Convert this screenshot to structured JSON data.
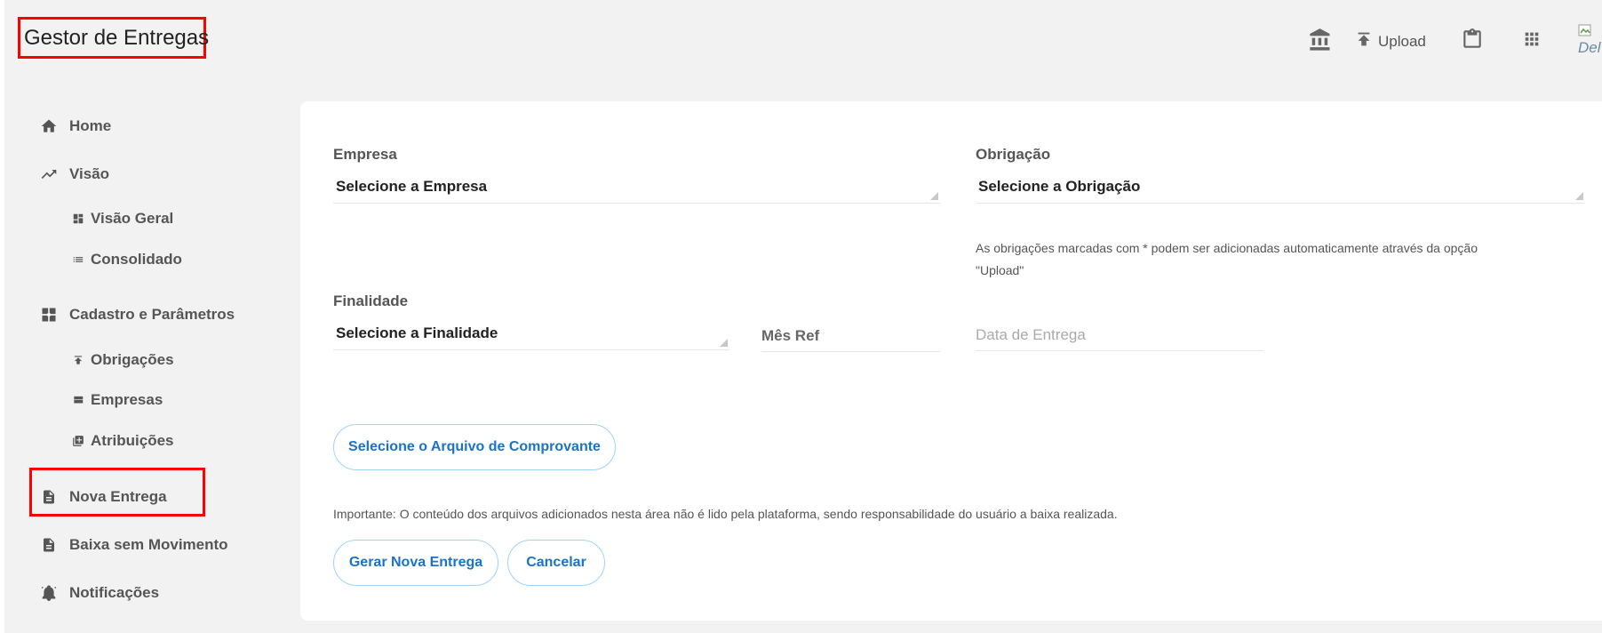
{
  "app": {
    "title": "Gestor de Entregas"
  },
  "topbar": {
    "upload_label": "Upload",
    "broken_image_alt": "Del"
  },
  "sidebar": {
    "items": [
      {
        "label": "Home",
        "icon": "home-icon"
      },
      {
        "label": "Visão",
        "icon": "trending-up-icon"
      },
      {
        "label": "Visão Geral",
        "icon": "dashboard-icon"
      },
      {
        "label": "Consolidado",
        "icon": "list-icon"
      },
      {
        "label": "Cadastro e Parâmetros",
        "icon": "settings-box-icon"
      },
      {
        "label": "Obrigações",
        "icon": "upload-small-icon"
      },
      {
        "label": "Empresas",
        "icon": "view-stream-icon"
      },
      {
        "label": "Atribuições",
        "icon": "add-to-queue-icon"
      },
      {
        "label": "Nova Entrega",
        "icon": "document-icon"
      },
      {
        "label": "Baixa sem Movimento",
        "icon": "document-icon"
      },
      {
        "label": "Notificações",
        "icon": "bell-icon"
      }
    ]
  },
  "form": {
    "empresa_label": "Empresa",
    "empresa_value": "Selecione a Empresa",
    "obrigacao_label": "Obrigação",
    "obrigacao_value": "Selecione a Obrigação",
    "obrigacao_hint_line1": "As obrigações marcadas com * podem ser adicionadas automaticamente através da opção",
    "obrigacao_hint_line2": "\"Upload\"",
    "finalidade_label": "Finalidade",
    "finalidade_value": "Selecione a Finalidade",
    "mes_ref_placeholder": "Mês Ref",
    "data_entrega_placeholder": "Data de Entrega",
    "file_button": "Selecione o Arquivo de Comprovante",
    "note": "Importante: O conteúdo dos arquivos adicionados nesta área não é lido pela plataforma, sendo responsabilidade do usuário a baixa realizada.",
    "submit_button": "Gerar Nova Entrega",
    "cancel_button": "Cancelar"
  },
  "colors": {
    "highlight": "#ff0000",
    "link_blue": "#1a73c9",
    "pill_border": "#9fd3f5"
  }
}
